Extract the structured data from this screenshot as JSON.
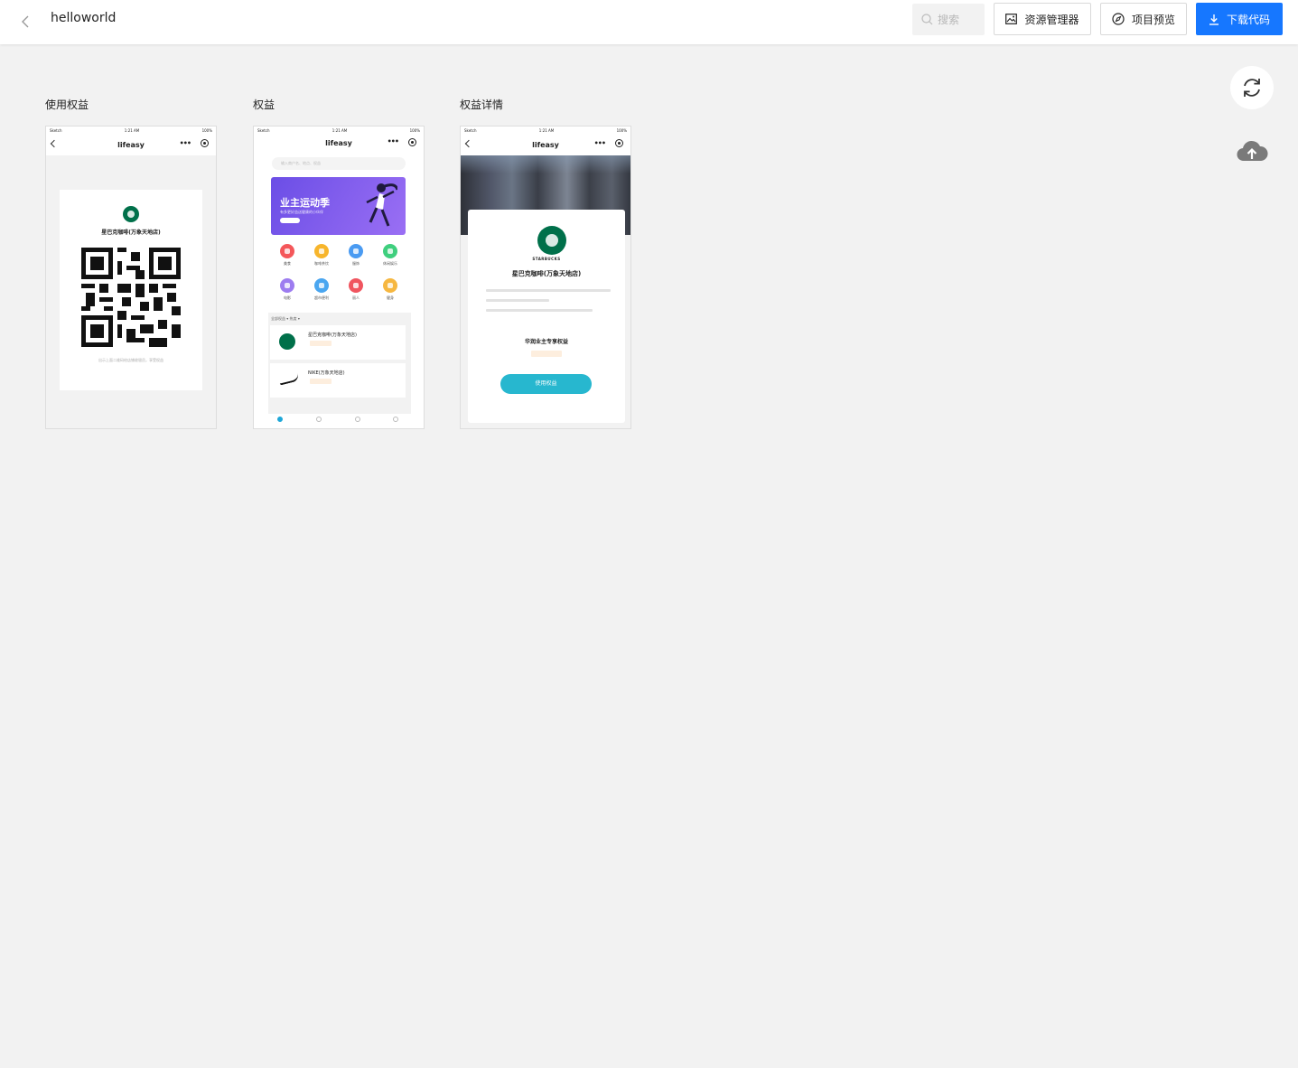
{
  "header": {
    "project_name": "helloworld",
    "search_placeholder": "搜索",
    "assets_label": "资源管理器",
    "preview_label": "项目预览",
    "download_label": "下载代码"
  },
  "colors": {
    "primary": "#1677ff",
    "background": "#f2f2f2",
    "accent_teal": "#27b7cf",
    "brand_green": "#00704a"
  },
  "icons": {
    "back": "chevron-left-icon",
    "search": "search-icon",
    "assets": "image-icon",
    "preview": "compass-icon",
    "download": "download-icon",
    "refresh": "refresh-icon",
    "upload": "cloud-upload-icon"
  },
  "pages": [
    {
      "title": "使用权益",
      "status": {
        "carrier": "Sketch",
        "time": "1:21 AM",
        "battery": "100%"
      },
      "nav_title": "lifeasy",
      "store_name": "星巴克咖啡(万象天地店)",
      "qr_note": "出示上面二维码给店铺收银员，享受权益"
    },
    {
      "title": "权益",
      "status": {
        "carrier": "Sketch",
        "time": "1:21 AM",
        "battery": "100%"
      },
      "nav_title": "lifeasy",
      "search_hint": "输入商户名、地点、权益",
      "banner_title": "业主运动季",
      "banner_sub": "有多更好益送健康的小伙伴",
      "categories": [
        "美食",
        "咖啡茶饮",
        "服饰",
        "休闲娱乐",
        "电影",
        "超市便利",
        "丽人",
        "健身"
      ],
      "list_tabs": "全部权益 ▾     热度 ▾",
      "stores": [
        "星巴克咖啡(万象天地店)",
        "NIKE(万象天地店)"
      ]
    },
    {
      "title": "权益详情",
      "status": {
        "carrier": "Sketch",
        "time": "1:21 AM",
        "battery": "100%"
      },
      "nav_title": "lifeasy",
      "brand": "STARBUCKS",
      "store_name": "星巴克咖啡(万象天地店)",
      "benefit_title": "华润业主专享权益",
      "action_label": "使用权益"
    }
  ]
}
